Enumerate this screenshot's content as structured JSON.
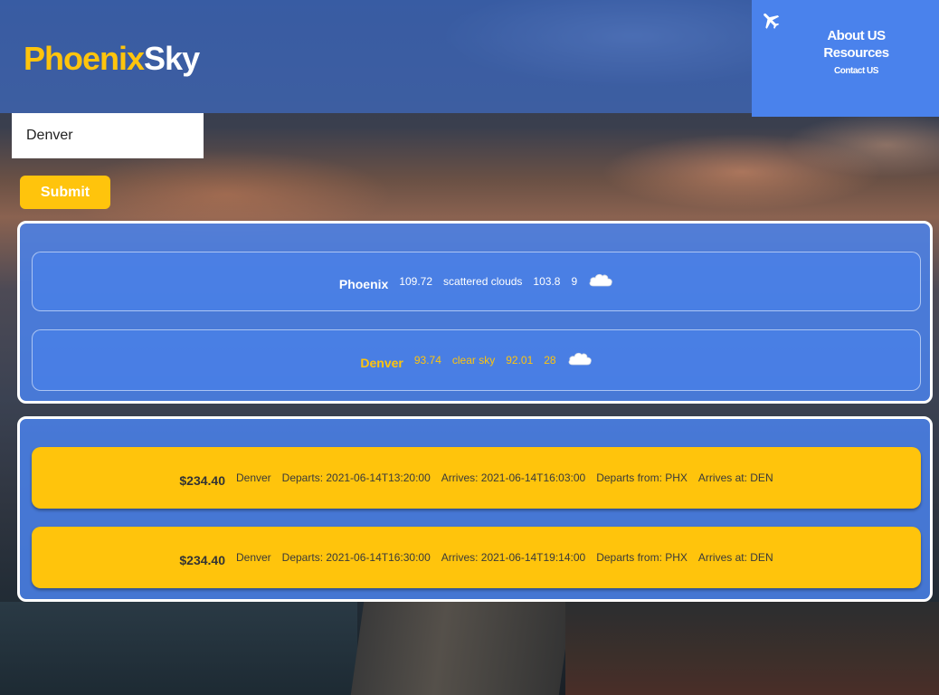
{
  "header": {
    "brand_part1": "Phoenix",
    "brand_part2": "Sky"
  },
  "nav": {
    "icon": "airplane-icon",
    "about": "About US",
    "resources": "Resources",
    "contact": "Contact US"
  },
  "search": {
    "value": "Denver",
    "submit_label": "Submit"
  },
  "weather": [
    {
      "city": "Phoenix",
      "temp": "109.72",
      "description": "scattered clouds",
      "feels_like": "103.8",
      "humidity": "9",
      "icon": "cloud-icon"
    },
    {
      "city": "Denver",
      "temp": "93.74",
      "description": "clear sky",
      "feels_like": "92.01",
      "humidity": "28",
      "icon": "cloud-icon"
    }
  ],
  "flights": [
    {
      "price": "$234.40",
      "destination": "Denver",
      "departs": "Departs: 2021-06-14T13:20:00",
      "arrives": "Arrives: 2021-06-14T16:03:00",
      "from": "Departs from: PHX",
      "to": "Arrives at: DEN"
    },
    {
      "price": "$234.40",
      "destination": "Denver",
      "departs": "Departs: 2021-06-14T16:30:00",
      "arrives": "Arrives: 2021-06-14T19:14:00",
      "from": "Departs from: PHX",
      "to": "Arrives at: DEN"
    }
  ],
  "colors": {
    "accent_yellow": "#ffc40c",
    "panel_blue": "#4a82ec",
    "white": "#ffffff"
  }
}
